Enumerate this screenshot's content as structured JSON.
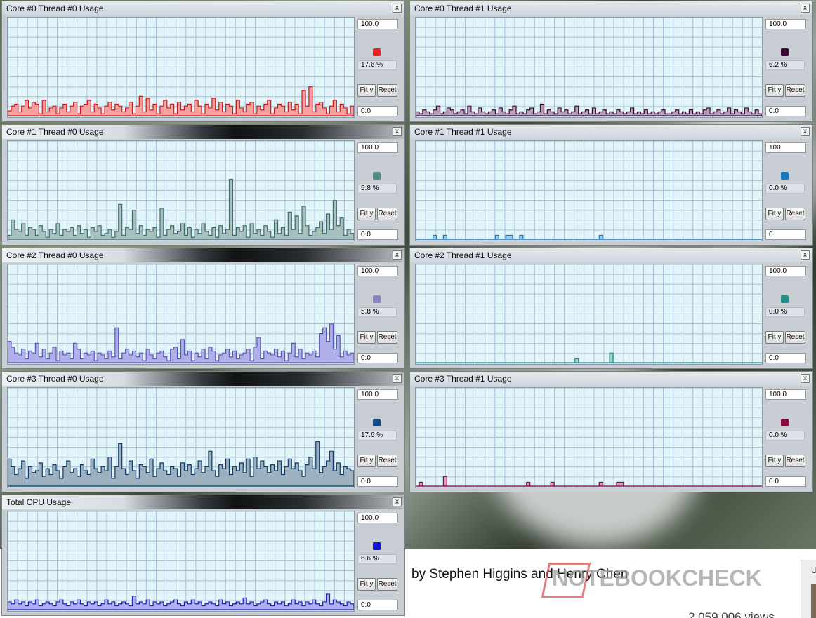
{
  "windows": [
    {
      "id": "c0t0",
      "title": "Core #0 Thread #0 Usage",
      "max": "100.0",
      "min": "0.0",
      "percent": "17.6 %",
      "color": "#f21b1b",
      "fill": "#f6a0a0",
      "line": "#d01818",
      "fit_label": "Fit y",
      "reset_label": "Reset",
      "close_label": "x",
      "values": [
        5,
        10,
        12,
        4,
        10,
        16,
        8,
        14,
        12,
        2,
        16,
        4,
        8,
        10,
        2,
        8,
        12,
        4,
        10,
        14,
        2,
        10,
        12,
        16,
        4,
        12,
        8,
        2,
        10,
        14,
        6,
        12,
        10,
        4,
        8,
        14,
        2,
        10,
        20,
        4,
        18,
        6,
        12,
        2,
        10,
        16,
        8,
        12,
        2,
        14,
        6,
        10,
        12,
        4,
        16,
        10,
        2,
        12,
        8,
        18,
        6,
        14,
        4,
        12,
        10,
        2,
        16,
        8,
        4,
        12,
        14,
        2,
        10,
        6,
        12,
        16,
        2,
        8,
        12,
        10,
        4,
        14,
        6,
        12,
        2,
        26,
        10,
        30,
        4,
        12,
        14,
        8,
        2,
        10,
        16,
        4,
        12,
        8,
        2,
        10
      ]
    },
    {
      "id": "c0t1",
      "title": "Core #0 Thread #1 Usage",
      "max": "100.0",
      "min": "0.0",
      "percent": "6.2 %",
      "color": "#3a0a34",
      "fill": "#b6a0b8",
      "line": "#3a0a34",
      "fit_label": "Fit y",
      "reset_label": "Reset",
      "close_label": "x",
      "values": [
        4,
        2,
        6,
        4,
        2,
        6,
        10,
        2,
        4,
        8,
        6,
        2,
        4,
        6,
        2,
        10,
        4,
        2,
        8,
        4,
        2,
        4,
        6,
        2,
        8,
        4,
        2,
        6,
        10,
        2,
        4,
        2,
        6,
        8,
        2,
        4,
        12,
        2,
        6,
        4,
        2,
        8,
        4,
        6,
        2,
        4,
        10,
        2,
        4,
        6,
        2,
        8,
        2,
        4,
        6,
        2,
        4,
        2,
        6,
        4,
        2,
        4,
        8,
        2,
        4,
        2,
        6,
        2,
        4,
        2,
        4,
        6,
        2,
        2,
        4,
        6,
        2,
        4,
        2,
        6,
        2,
        4,
        2,
        6,
        8,
        2,
        4,
        6,
        2,
        4,
        8,
        2,
        6,
        4,
        2,
        8,
        4,
        2,
        6,
        2
      ]
    },
    {
      "id": "c1t0",
      "title": "Core #1 Thread #0 Usage",
      "max": "100.0",
      "min": "0.0",
      "percent": "5.8 %",
      "color": "#4f8a86",
      "fill": "#a9bfbd",
      "line": "#3d6e6a",
      "fit_label": "Fit y",
      "reset_label": "Reset",
      "close_label": "x",
      "values": [
        4,
        20,
        10,
        8,
        16,
        4,
        12,
        10,
        4,
        14,
        8,
        2,
        10,
        6,
        16,
        4,
        10,
        8,
        12,
        4,
        14,
        6,
        10,
        2,
        12,
        8,
        14,
        4,
        6,
        10,
        2,
        8,
        36,
        4,
        12,
        10,
        30,
        6,
        14,
        4,
        10,
        8,
        12,
        2,
        32,
        4,
        10,
        14,
        6,
        8,
        16,
        4,
        12,
        2,
        10,
        6,
        16,
        8,
        4,
        12,
        2,
        14,
        6,
        10,
        62,
        4,
        12,
        8,
        14,
        2,
        16,
        6,
        10,
        4,
        14,
        8,
        2,
        20,
        6,
        12,
        4,
        28,
        10,
        24,
        6,
        34,
        14,
        4,
        8,
        12,
        18,
        6,
        26,
        10,
        40,
        14,
        22,
        4,
        10,
        6
      ]
    },
    {
      "id": "c1t1",
      "title": "Core #1 Thread #1 Usage",
      "max": "100",
      "min": "0",
      "percent": "0.0 %",
      "color": "#1a78c0",
      "fill": "#9dc7e6",
      "line": "#1a78c0",
      "fit_label": "Fit y",
      "reset_label": "Reset",
      "close_label": "x",
      "values": [
        0,
        0,
        0,
        0,
        0,
        4,
        0,
        0,
        4,
        0,
        0,
        0,
        0,
        0,
        0,
        0,
        0,
        0,
        0,
        0,
        0,
        0,
        0,
        4,
        0,
        0,
        4,
        4,
        0,
        0,
        4,
        0,
        0,
        0,
        0,
        0,
        0,
        0,
        0,
        0,
        0,
        0,
        0,
        0,
        0,
        0,
        0,
        0,
        0,
        0,
        0,
        0,
        0,
        4,
        0,
        0,
        0,
        0,
        0,
        0,
        0,
        0,
        0,
        0,
        0,
        0,
        0,
        0,
        0,
        0,
        0,
        0,
        0,
        0,
        0,
        0,
        0,
        0,
        0,
        0,
        0,
        0,
        0,
        0,
        0,
        0,
        0,
        0,
        0,
        0,
        0,
        0,
        0,
        0,
        0,
        0,
        0,
        0,
        0,
        0
      ]
    },
    {
      "id": "c2t0",
      "title": "Core #2 Thread #0 Usage",
      "max": "100.0",
      "min": "0.0",
      "percent": "5.8 %",
      "color": "#8a86c6",
      "fill": "#b1afe8",
      "line": "#5a56b8",
      "fit_label": "Fit y",
      "reset_label": "Reset",
      "close_label": "x",
      "values": [
        22,
        16,
        10,
        8,
        14,
        4,
        12,
        10,
        20,
        6,
        14,
        4,
        10,
        16,
        2,
        12,
        8,
        10,
        4,
        20,
        14,
        4,
        10,
        8,
        12,
        2,
        10,
        8,
        4,
        12,
        6,
        36,
        4,
        10,
        14,
        8,
        12,
        6,
        10,
        2,
        14,
        8,
        4,
        10,
        12,
        6,
        2,
        14,
        16,
        4,
        24,
        8,
        12,
        2,
        10,
        6,
        14,
        4,
        16,
        12,
        2,
        8,
        10,
        14,
        6,
        12,
        4,
        8,
        10,
        14,
        2,
        16,
        26,
        4,
        12,
        10,
        8,
        14,
        6,
        12,
        2,
        10,
        20,
        6,
        14,
        4,
        10,
        8,
        12,
        6,
        30,
        36,
        22,
        40,
        14,
        28,
        6,
        12,
        8,
        10
      ]
    },
    {
      "id": "c2t1",
      "title": "Core #2 Thread #1 Usage",
      "max": "100.0",
      "min": "0.0",
      "percent": "0.0 %",
      "color": "#1f8f8a",
      "fill": "#9dd0cc",
      "line": "#1f8f8a",
      "fit_label": "Fit y",
      "reset_label": "Reset",
      "close_label": "x",
      "values": [
        0,
        0,
        0,
        0,
        0,
        0,
        0,
        0,
        0,
        0,
        0,
        0,
        0,
        0,
        0,
        0,
        0,
        0,
        0,
        0,
        0,
        0,
        0,
        0,
        0,
        0,
        0,
        0,
        0,
        0,
        0,
        0,
        0,
        0,
        0,
        0,
        0,
        0,
        0,
        0,
        0,
        0,
        0,
        0,
        0,
        0,
        4,
        0,
        0,
        0,
        0,
        0,
        0,
        0,
        0,
        0,
        10,
        0,
        0,
        0,
        0,
        0,
        0,
        0,
        0,
        0,
        0,
        0,
        0,
        0,
        0,
        0,
        0,
        0,
        0,
        0,
        0,
        0,
        0,
        0,
        0,
        0,
        0,
        0,
        0,
        0,
        0,
        0,
        0,
        0,
        0,
        0,
        0,
        0,
        0,
        0,
        0,
        0,
        0,
        0
      ]
    },
    {
      "id": "c3t0",
      "title": "Core #3 Thread #0 Usage",
      "max": "100.0",
      "min": "0.0",
      "percent": "17.6 %",
      "color": "#0f4c8a",
      "fill": "#9db0c0",
      "line": "#0f3c6a",
      "fit_label": "Fit y",
      "reset_label": "Reset",
      "close_label": "x",
      "values": [
        28,
        20,
        12,
        18,
        26,
        8,
        20,
        14,
        16,
        24,
        10,
        18,
        12,
        22,
        16,
        8,
        20,
        26,
        14,
        18,
        10,
        22,
        16,
        12,
        28,
        18,
        14,
        20,
        16,
        30,
        8,
        20,
        44,
        18,
        12,
        26,
        16,
        8,
        22,
        20,
        14,
        28,
        10,
        18,
        24,
        16,
        12,
        20,
        18,
        10,
        24,
        16,
        22,
        12,
        18,
        26,
        14,
        20,
        36,
        16,
        10,
        22,
        18,
        28,
        12,
        20,
        16,
        24,
        14,
        28,
        10,
        30,
        18,
        26,
        20,
        14,
        22,
        16,
        26,
        12,
        20,
        28,
        18,
        24,
        16,
        10,
        22,
        30,
        18,
        46,
        14,
        20,
        26,
        36,
        16,
        24,
        12,
        20,
        18,
        16
      ]
    },
    {
      "id": "c3t1",
      "title": "Core #3 Thread #1 Usage",
      "max": "100.0",
      "min": "0.0",
      "percent": "0.0 %",
      "color": "#8a0a3c",
      "fill": "#d8a0b8",
      "line": "#8a0a3c",
      "fit_label": "Fit y",
      "reset_label": "Reset",
      "close_label": "x",
      "values": [
        0,
        4,
        0,
        0,
        0,
        0,
        0,
        0,
        10,
        0,
        0,
        0,
        0,
        0,
        0,
        0,
        0,
        0,
        0,
        0,
        0,
        0,
        0,
        0,
        0,
        0,
        0,
        0,
        0,
        0,
        0,
        0,
        4,
        0,
        0,
        0,
        0,
        0,
        0,
        4,
        0,
        0,
        0,
        0,
        0,
        0,
        0,
        0,
        0,
        0,
        0,
        0,
        0,
        4,
        0,
        0,
        0,
        0,
        4,
        4,
        0,
        0,
        0,
        0,
        0,
        0,
        0,
        0,
        0,
        0,
        0,
        0,
        0,
        0,
        0,
        0,
        0,
        0,
        0,
        0,
        0,
        0,
        0,
        0,
        0,
        0,
        0,
        0,
        0,
        0,
        0,
        0,
        0,
        0,
        0,
        0,
        0,
        0,
        0,
        0
      ]
    },
    {
      "id": "total",
      "title": "Total CPU Usage",
      "max": "100.0",
      "min": "0.0",
      "percent": "6.6 %",
      "color": "#1010e0",
      "fill": "#aeaef0",
      "line": "#2020c0",
      "fit_label": "Fit y",
      "reset_label": "Reset",
      "close_label": "x",
      "values": [
        8,
        6,
        10,
        6,
        8,
        4,
        8,
        6,
        10,
        4,
        6,
        8,
        6,
        4,
        8,
        10,
        6,
        4,
        8,
        6,
        10,
        6,
        4,
        8,
        6,
        8,
        4,
        6,
        10,
        6,
        8,
        4,
        6,
        8,
        6,
        4,
        14,
        6,
        8,
        6,
        10,
        4,
        8,
        6,
        8,
        4,
        6,
        8,
        10,
        6,
        4,
        8,
        6,
        10,
        6,
        8,
        4,
        6,
        8,
        6,
        4,
        10,
        6,
        8,
        4,
        6,
        8,
        6,
        12,
        6,
        8,
        4,
        6,
        8,
        10,
        6,
        4,
        8,
        6,
        8,
        4,
        6,
        10,
        6,
        8,
        4,
        8,
        6,
        10,
        6,
        4,
        8,
        16,
        6,
        10,
        8,
        6,
        4,
        8,
        6
      ]
    }
  ],
  "background": {
    "byline": "by Stephen Higgins and Henry Chen",
    "views": "2,059,006 views",
    "logo": "NOTEBOOKCHECK",
    "side_label": "U"
  }
}
